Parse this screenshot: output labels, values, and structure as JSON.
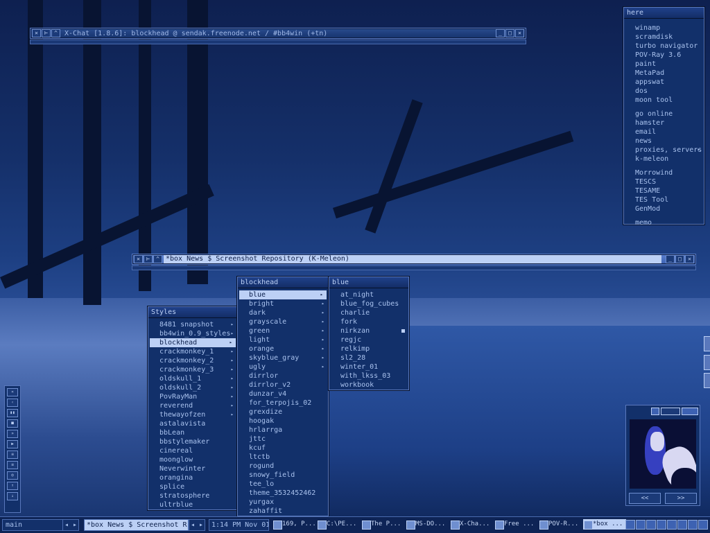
{
  "xchat_window": {
    "title": "X-Chat [1.8.6]: blockhead @ sendak.freenode.net / #bb4win (+tn)"
  },
  "browser_window": {
    "title": "*box News $ Screenshot Repository (K-Meleon)"
  },
  "here_menu": {
    "title": "here",
    "groups": [
      [
        "winamp",
        "scramdisk",
        "turbo navigator",
        "POV-Ray 3.6",
        "paint",
        "MetaPad",
        "appswat",
        "dos",
        "moon tool"
      ],
      [
        "go online",
        "hamster",
        "email",
        "news",
        "proxies, servers",
        "k-meleon"
      ],
      [
        "Morrowind",
        "TESCS",
        "TESAME",
        "TES Tool",
        "GenMod"
      ],
      [
        "memo"
      ]
    ],
    "submenu_items": [
      "proxies, servers"
    ]
  },
  "styles_menu": {
    "title": "Styles",
    "items": [
      "8481 snapshot",
      "bb4win_0.9_styles",
      "blockhead",
      "crackmonkey_1",
      "crackmonkey_2",
      "crackmonkey_3",
      "oldskull_1",
      "oldskull_2",
      "PovRayMan",
      "reverend",
      "thewayofzen",
      "astalavista",
      "bbLean",
      "bbstylemaker",
      "cinereal",
      "moonglow",
      "Neverwinter",
      "orangina",
      "splice",
      "stratosphere",
      "ultrblue"
    ],
    "selected": "blockhead",
    "submenu_items": [
      "8481 snapshot",
      "bb4win_0.9_styles",
      "blockhead",
      "crackmonkey_1",
      "crackmonkey_2",
      "crackmonkey_3",
      "oldskull_1",
      "oldskull_2",
      "PovRayMan",
      "reverend",
      "thewayofzen"
    ]
  },
  "blockhead_menu": {
    "title": "blockhead",
    "items": [
      "blue",
      "bright",
      "dark",
      "grayscale",
      "green",
      "light",
      "orange",
      "skyblue_gray",
      "ugly",
      "dirrlor",
      "dirrlor_v2",
      "dunzar_v4",
      "for_terpojis_02",
      "grexdize",
      "hoogak",
      "hrlarrga",
      "jttc",
      "kcuf",
      "ltctb",
      "rogund",
      "snowy_field",
      "tee_lo",
      "theme_3532452462",
      "yurgax",
      "zahaffit"
    ],
    "selected": "blue",
    "submenu_items": [
      "blue",
      "bright",
      "dark",
      "grayscale",
      "green",
      "light",
      "orange",
      "skyblue_gray",
      "ugly"
    ]
  },
  "blue_menu": {
    "title": "blue",
    "items": [
      "at_night",
      "blue_fog_cubes",
      "charlie",
      "fork",
      "nirkzan",
      "regjc",
      "relkimp",
      "sl2_28",
      "winter_01",
      "with_lkss_03",
      "workbook"
    ],
    "marked": "nirkzan"
  },
  "player": {
    "buttons": [
      "«",
      "‹",
      "▮▮",
      "■",
      "»",
      "▶",
      "≡",
      "≡",
      "◎",
      "↑",
      "↓"
    ]
  },
  "image_widget": {
    "prev": "<<",
    "next": ">>"
  },
  "taskbar": {
    "workspace": "main",
    "current_window": "*box News $ Screenshot R...",
    "clock": "1:14 PM Nov 01",
    "tasks": [
      {
        "label": "169, P...",
        "icon": "app-icon"
      },
      {
        "label": "C:\\PE...",
        "icon": "folder-icon"
      },
      {
        "label": "The P...",
        "icon": "app-icon"
      },
      {
        "label": "MS-DO...",
        "icon": "dos-icon"
      },
      {
        "label": "X-Cha...",
        "icon": "chat-icon"
      },
      {
        "label": "Free ...",
        "icon": "app-icon"
      },
      {
        "label": "POV-R...",
        "icon": "povray-icon"
      },
      {
        "label": "*box ...",
        "icon": "browser-icon",
        "active": true
      }
    ]
  },
  "colors": {
    "accent": "#bcd0f5",
    "panel": "#12306a",
    "border": "#5a78bc"
  }
}
